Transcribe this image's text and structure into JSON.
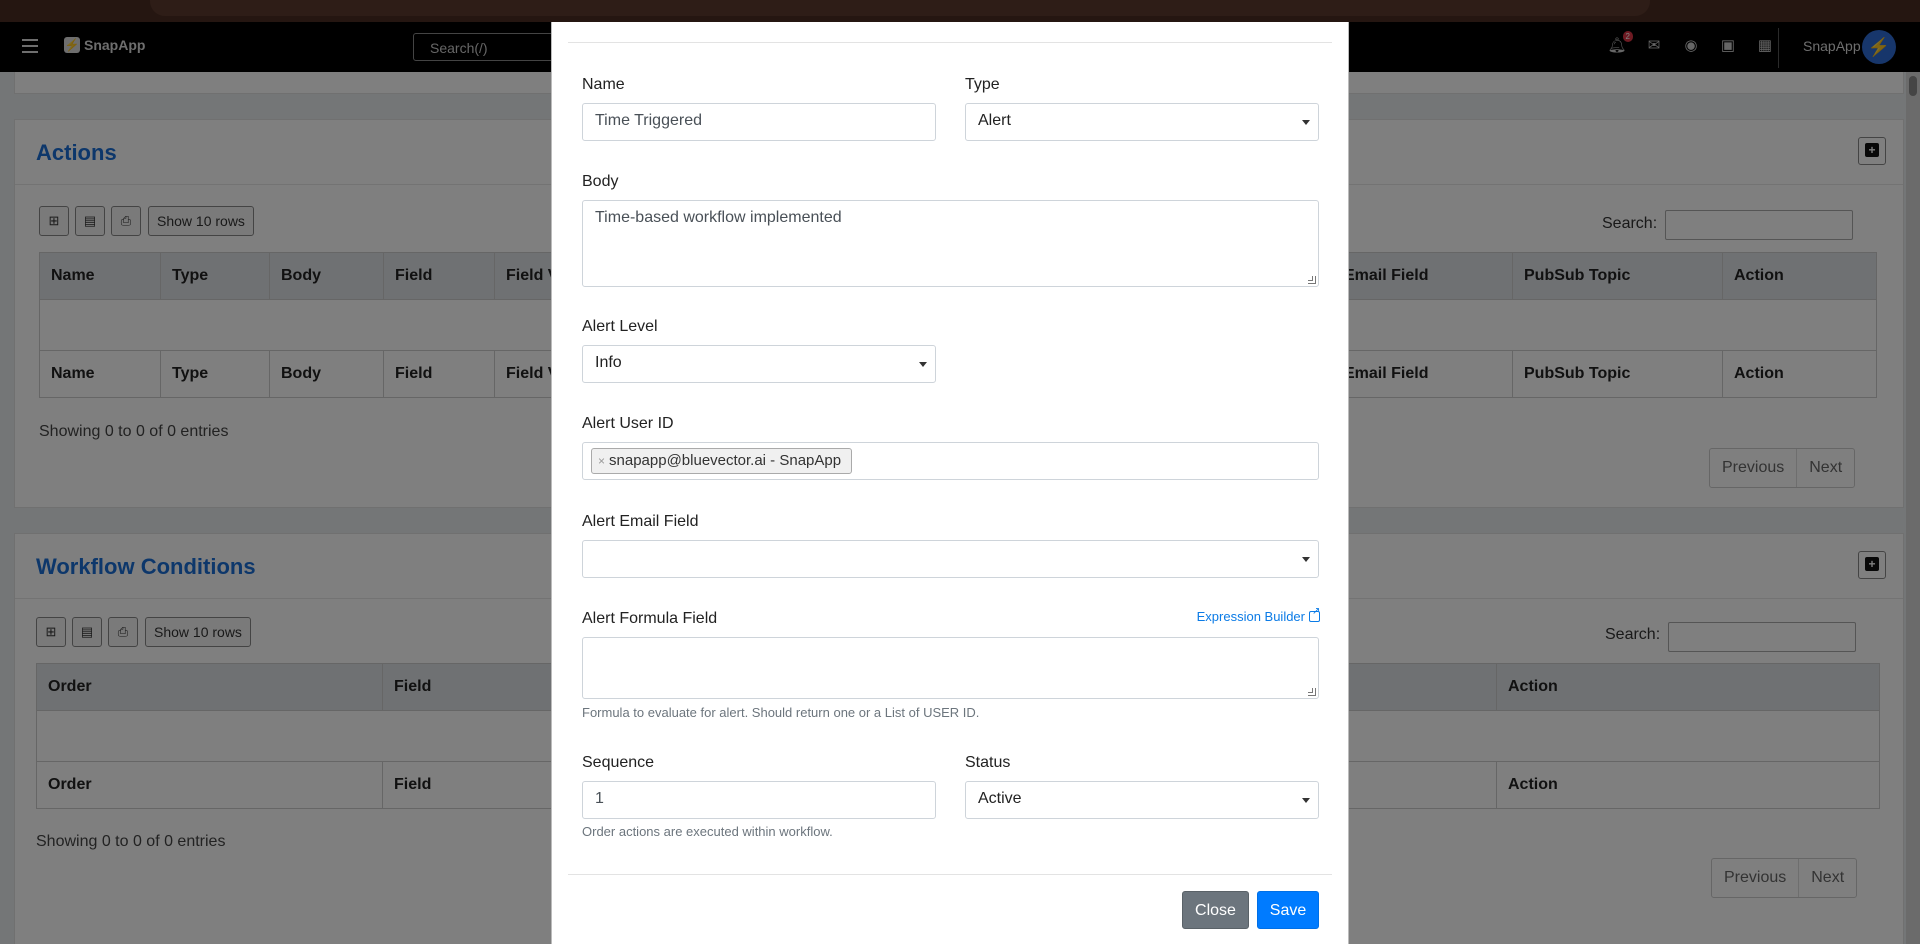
{
  "app": {
    "name": "SnapApp",
    "search_placeholder": "Search(/)",
    "notification_count": "2",
    "user_name": "SnapApp"
  },
  "actions_panel": {
    "title": "Actions",
    "rows_button": "Show 10 rows",
    "search_label": "Search:",
    "columns": [
      "Name",
      "Type",
      "Body",
      "Field",
      "Field V",
      "Email Field",
      "PubSub Topic",
      "Action"
    ],
    "footer_columns": [
      "Name",
      "Type",
      "Body",
      "Field",
      "Field V",
      "Email Field",
      "PubSub Topic",
      "Action"
    ],
    "info": "Showing 0 to 0 of 0 entries",
    "prev": "Previous",
    "next": "Next"
  },
  "conditions_panel": {
    "title": "Workflow Conditions",
    "rows_button": "Show 10 rows",
    "search_label": "Search:",
    "columns": [
      "Order",
      "Field",
      "Action"
    ],
    "footer_columns": [
      "Order",
      "Field",
      "Action"
    ],
    "info": "Showing 0 to 0 of 0 entries",
    "prev": "Previous",
    "next": "Next"
  },
  "modal": {
    "name_label": "Name",
    "name_value": "Time Triggered",
    "type_label": "Type",
    "type_value": "Alert",
    "body_label": "Body",
    "body_value": "Time-based workflow implemented",
    "alert_level_label": "Alert Level",
    "alert_level_value": "Info",
    "alert_user_label": "Alert User ID",
    "alert_user_chip": "snapapp@bluevector.ai - SnapApp",
    "alert_email_label": "Alert Email Field",
    "alert_email_value": "",
    "formula_label": "Alert Formula Field",
    "expression_builder": "Expression Builder",
    "formula_hint": "Formula to evaluate for alert. Should return one or a List of USER ID.",
    "sequence_label": "Sequence",
    "sequence_value": "1",
    "sequence_hint": "Order actions are executed within workflow.",
    "status_label": "Status",
    "status_value": "Active",
    "close_button": "Close",
    "save_button": "Save"
  },
  "icons": {
    "menu": "hamburger-icon",
    "bell": "bell-icon",
    "mail": "envelope-icon",
    "dashboard": "gauge-icon",
    "id_card": "id-card-icon",
    "apps": "grid-icon",
    "avatar": "bolt-icon"
  },
  "colors": {
    "accent": "#1a6fd6",
    "primary_button": "#007bff",
    "secondary_button": "#6c757d",
    "avatar": "#2f6dd6"
  }
}
